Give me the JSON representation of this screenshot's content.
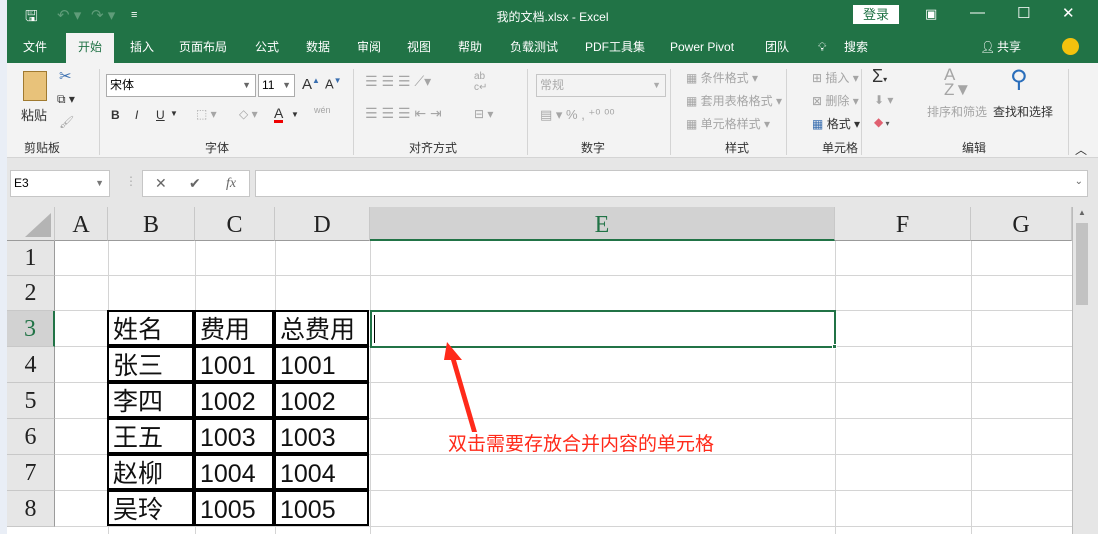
{
  "title": "我的文档.xlsx  -  Excel",
  "login": "登录",
  "tabs": [
    "文件",
    "开始",
    "插入",
    "页面布局",
    "公式",
    "数据",
    "审阅",
    "视图",
    "帮助",
    "负载测试",
    "PDF工具集",
    "Power Pivot",
    "团队"
  ],
  "search": "搜索",
  "share": "共享",
  "ribbon": {
    "paste": "粘贴",
    "clipboard": "剪贴板",
    "font_name": "宋体",
    "font_size": "11",
    "font_group": "字体",
    "bold": "B",
    "italic": "I",
    "underline": "U",
    "wen": "wén",
    "align_group": "对齐方式",
    "number_format": "常规",
    "number_group": "数字",
    "cond_format": "条件格式",
    "table_format": "套用表格格式",
    "cell_style": "单元格样式",
    "styles_group": "样式",
    "insert": "插入",
    "delete": "删除",
    "format": "格式",
    "cells_group": "单元格",
    "sort_filter": "排序和筛选",
    "find_select": "查找和选择",
    "editing_group": "编辑"
  },
  "formula": {
    "name_box": "E3",
    "fx": "fx",
    "value": ""
  },
  "columns": [
    "A",
    "B",
    "C",
    "D",
    "E",
    "F",
    "G"
  ],
  "rows": [
    "1",
    "2",
    "3",
    "4",
    "5",
    "6",
    "7",
    "8"
  ],
  "selected_cell": "E3",
  "table": [
    [
      "姓名",
      "费用",
      "总费用"
    ],
    [
      "张三",
      "1001",
      "1001"
    ],
    [
      "李四",
      "1002",
      "1002"
    ],
    [
      "王五",
      "1003",
      "1003"
    ],
    [
      "赵柳",
      "1004",
      "1004"
    ],
    [
      "吴玲",
      "1005",
      "1005"
    ]
  ],
  "annotation": "双击需要存放合并内容的单元格",
  "colors": {
    "brand": "#217346",
    "annotation": "#ff2a1a"
  }
}
